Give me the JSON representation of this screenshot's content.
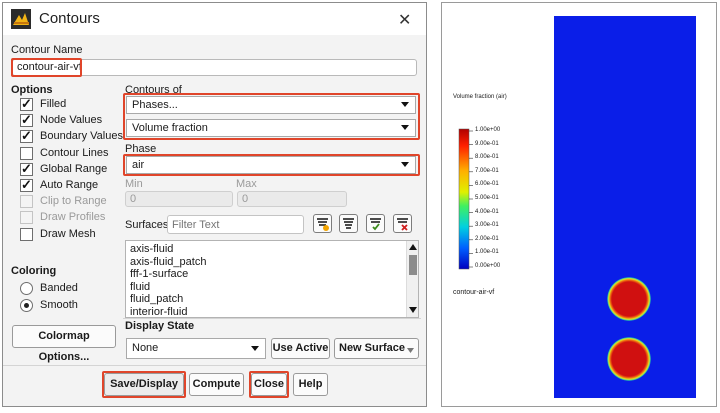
{
  "dialog": {
    "title": "Contours",
    "contour_name_label": "Contour Name",
    "contour_name_value": "contour-air-vf",
    "options_label": "Options",
    "options": [
      {
        "label": "Filled",
        "checked": true,
        "enabled": true
      },
      {
        "label": "Node Values",
        "checked": true,
        "enabled": true
      },
      {
        "label": "Boundary Values",
        "checked": true,
        "enabled": true
      },
      {
        "label": "Contour Lines",
        "checked": false,
        "enabled": true
      },
      {
        "label": "Global Range",
        "checked": true,
        "enabled": true
      },
      {
        "label": "Auto Range",
        "checked": true,
        "enabled": true
      },
      {
        "label": "Clip to Range",
        "checked": false,
        "enabled": false
      },
      {
        "label": "Draw Profiles",
        "checked": false,
        "enabled": false
      },
      {
        "label": "Draw Mesh",
        "checked": false,
        "enabled": true
      }
    ],
    "contours_of_label": "Contours of",
    "contours_of_value": "Phases...",
    "contours_sub_value": "Volume fraction",
    "phase_label": "Phase",
    "phase_value": "air",
    "min_label": "Min",
    "min_value": "0",
    "max_label": "Max",
    "max_value": "0",
    "surfaces_label": "Surfaces",
    "surfaces_placeholder": "Filter Text",
    "surfaces": [
      "axis-fluid",
      "axis-fluid_patch",
      "fff-1-surface",
      "fluid",
      "fluid_patch",
      "interior-fluid"
    ],
    "coloring_label": "Coloring",
    "coloring": [
      {
        "label": "Banded",
        "selected": false
      },
      {
        "label": "Smooth",
        "selected": true
      }
    ],
    "colormap_button": "Colormap Options...",
    "display_state_label": "Display State",
    "display_state_value": "None",
    "use_active_button": "Use Active",
    "new_surface_button": "New Surface",
    "save_display_button": "Save/Display",
    "compute_button": "Compute",
    "close_button": "Close",
    "help_button": "Help"
  },
  "viewer": {
    "legend_title": "Volume fraction (air)",
    "tick_labels": [
      "1.00e+00",
      "9.00e-01",
      "8.00e-01",
      "7.00e-01",
      "6.00e-01",
      "5.00e-01",
      "4.00e-01",
      "3.00e-01",
      "2.00e-01",
      "1.00e-01",
      "0.00e+00"
    ],
    "contour_name": "contour-air-vf",
    "colors": {
      "background_field": "#0a1ee8",
      "bubble": "#d01010",
      "bubble_edge": "#f0d020"
    }
  }
}
